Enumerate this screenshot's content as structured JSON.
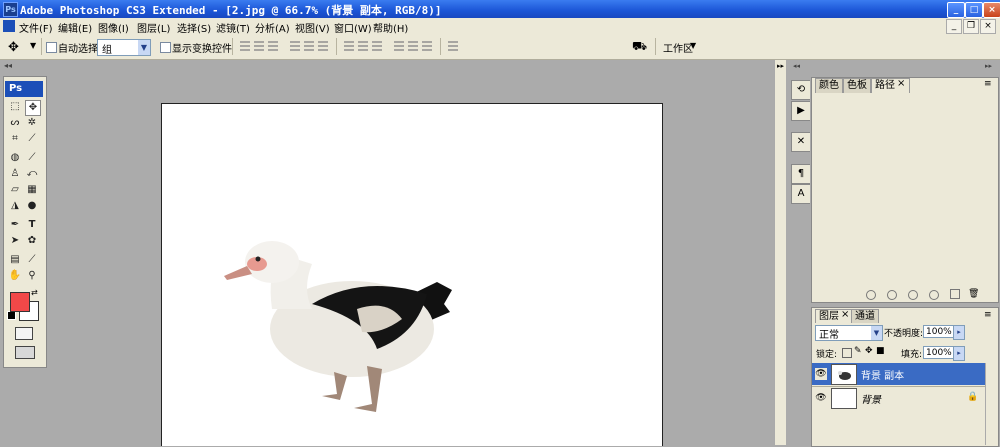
{
  "window": {
    "app_badge": "Ps",
    "title": "Adobe Photoshop CS3 Extended - [2.jpg @ 66.7% (背景 副本, RGB/8)]",
    "minimize": "_",
    "maximize": "□",
    "close": "×"
  },
  "menu": {
    "items": [
      "文件(F)",
      "编辑(E)",
      "图像(I)",
      "图层(L)",
      "选择(S)",
      "滤镜(T)",
      "分析(A)",
      "视图(V)",
      "窗口(W)",
      "帮助(H)"
    ],
    "doc_minimize": "_",
    "doc_restore": "❐",
    "doc_close": "×"
  },
  "options": {
    "auto_select_label": "自动选择:",
    "auto_select_value": "组",
    "show_transform_label": "显示变换控件",
    "workspace_label": "工作区"
  },
  "toolbox": {
    "logo": "Ps"
  },
  "panels": {
    "top_tabs": [
      "颜色",
      "色板",
      "路径"
    ],
    "layer_tabs": [
      "图层",
      "通道"
    ],
    "blend_mode": "正常",
    "opacity_label": "不透明度:",
    "opacity_value": "100%",
    "lock_label": "锁定:",
    "fill_label": "填充:",
    "fill_value": "100%",
    "layers": [
      {
        "name": "背景 副本",
        "selected": true
      },
      {
        "name": "背景",
        "selected": false
      }
    ]
  },
  "colors": {
    "foreground": "#f24848",
    "background": "#ffffff",
    "title_bar": "#1b55d6",
    "selected_layer": "#3a6bc4"
  }
}
